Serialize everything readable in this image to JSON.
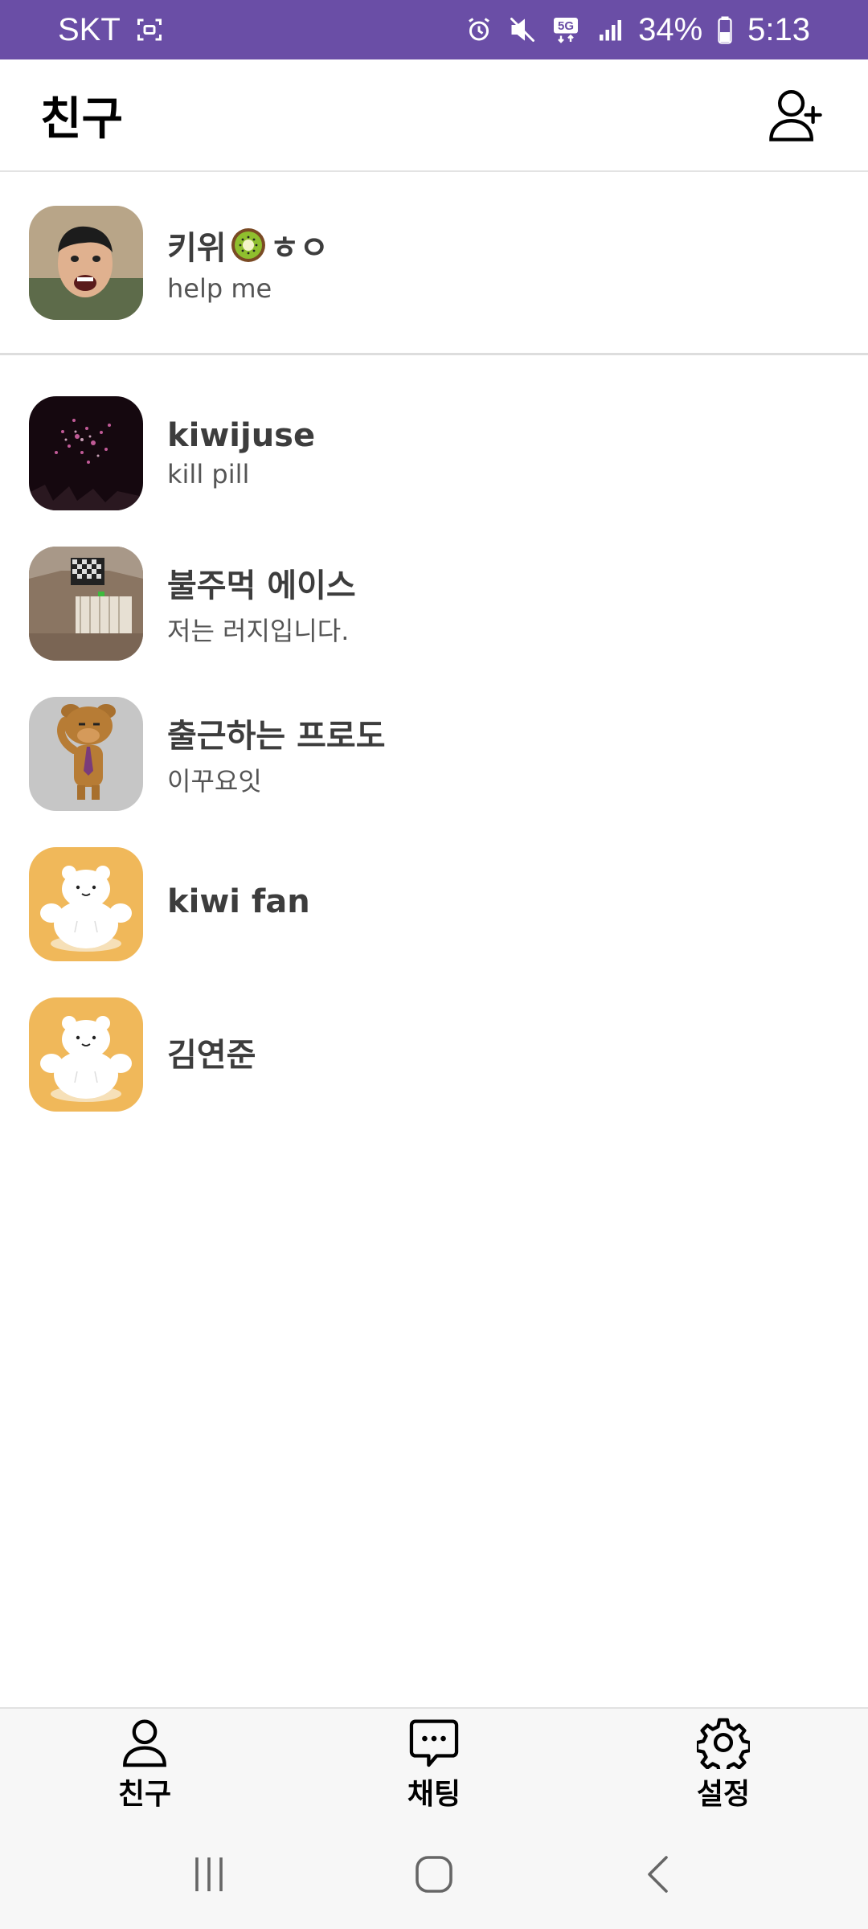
{
  "status_bar": {
    "carrier": "SKT",
    "network": "5G",
    "battery": "34%",
    "time": "5:13",
    "background": "#6a4ea6",
    "icons": [
      "screen-record-icon",
      "alarm-icon",
      "mute-icon",
      "5g-icon",
      "signal-icon",
      "battery-icon"
    ]
  },
  "header": {
    "title": "친구",
    "add_friend_icon": "add-person-icon"
  },
  "my_profile": {
    "name": "키위",
    "name_suffix": "ㅎㅇ",
    "emoji": "kiwi-emoji",
    "status": "help me"
  },
  "friends": [
    {
      "name": "kiwijuse",
      "status": "kill pill",
      "avatar": "fireworks"
    },
    {
      "name": "불주먹 에이스",
      "status": "저는 러지입니다.",
      "avatar": "room"
    },
    {
      "name": "출근하는 프로도",
      "status": "이꾸요잇",
      "avatar": "frodo"
    },
    {
      "name": "kiwi fan",
      "status": "",
      "avatar": "bear"
    },
    {
      "name": "김연준",
      "status": "",
      "avatar": "bear"
    }
  ],
  "bottom_nav": {
    "items": [
      {
        "label": "친구",
        "icon": "person-icon",
        "active": true
      },
      {
        "label": "채팅",
        "icon": "chat-bubble-icon",
        "active": false
      },
      {
        "label": "설정",
        "icon": "gear-icon",
        "active": false
      }
    ]
  },
  "system_nav": {
    "buttons": [
      "recent-apps-icon",
      "home-icon",
      "back-icon"
    ]
  },
  "colors": {
    "accent": "#6a4ea6",
    "bear_bg": "#f0b85a",
    "frodo_bg": "#c6c6c6",
    "text_primary": "#3d3d3d",
    "text_secondary": "#555555"
  }
}
